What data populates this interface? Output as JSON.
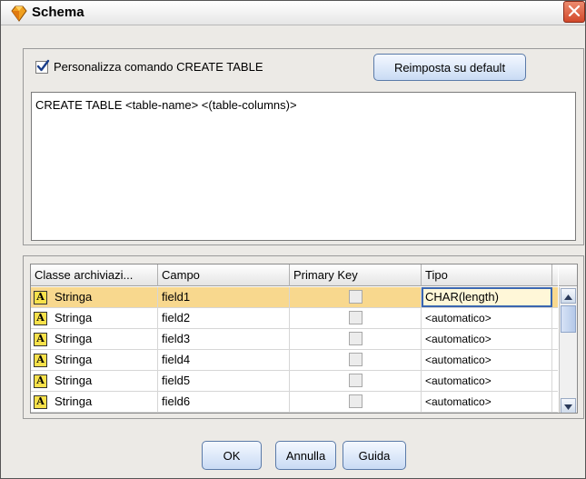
{
  "window": {
    "title": "Schema",
    "icon": "diamond-node-icon",
    "close_icon": "close-icon"
  },
  "create_table": {
    "checkbox_label": "Personalizza comando CREATE TABLE",
    "checkbox_checked": true,
    "reset_button": "Reimposta su default",
    "command_text": "CREATE TABLE <table-name> <(table-columns)>"
  },
  "table": {
    "columns": [
      "Classe archiviazi...",
      "Campo",
      "Primary Key",
      "Tipo"
    ],
    "rows": [
      {
        "storage": "Stringa",
        "field": "field1",
        "primary_key": false,
        "type": "CHAR(length)",
        "selected": true
      },
      {
        "storage": "Stringa",
        "field": "field2",
        "primary_key": false,
        "type": "<automatico>"
      },
      {
        "storage": "Stringa",
        "field": "field3",
        "primary_key": false,
        "type": "<automatico>"
      },
      {
        "storage": "Stringa",
        "field": "field4",
        "primary_key": false,
        "type": "<automatico>"
      },
      {
        "storage": "Stringa",
        "field": "field5",
        "primary_key": false,
        "type": "<automatico>"
      },
      {
        "storage": "Stringa",
        "field": "field6",
        "primary_key": false,
        "type": "<automatico>"
      }
    ],
    "storage_icon_letter": "A"
  },
  "buttons": {
    "ok": "OK",
    "cancel": "Annulla",
    "help": "Guida"
  },
  "colors": {
    "selected_row": "#f8d88e",
    "button_border": "#5a7aa8",
    "close_button": "#d2482a"
  }
}
